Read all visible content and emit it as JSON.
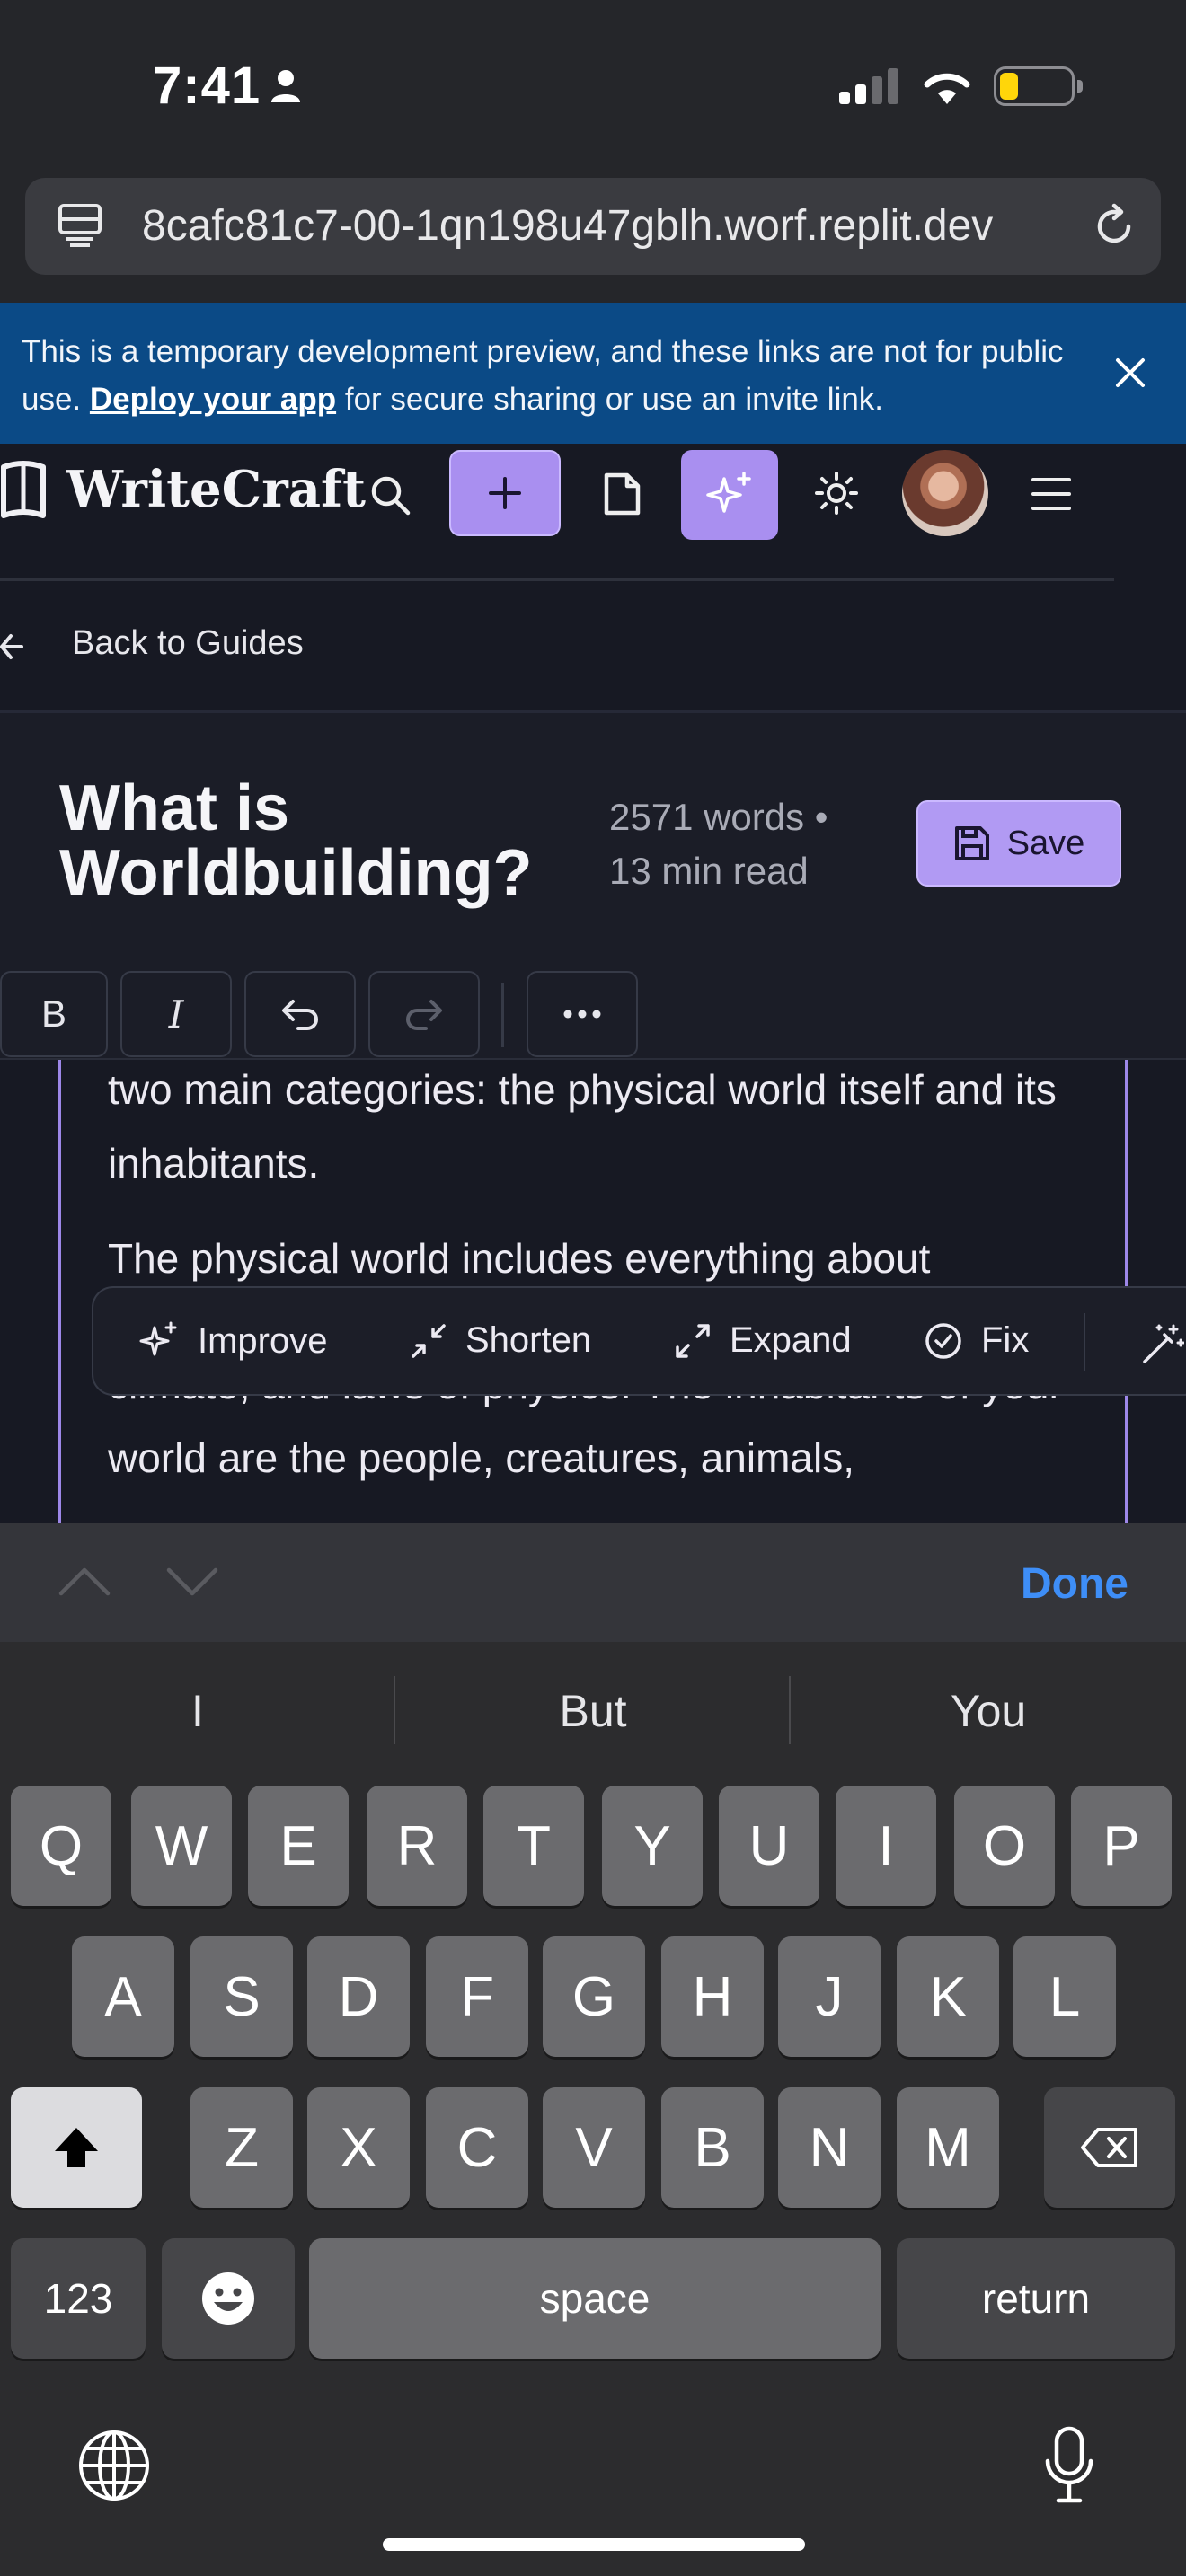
{
  "status_bar": {
    "time": "7:41"
  },
  "browser": {
    "url": "8cafc81c7-00-1qn198u47gblh.worf.replit.dev"
  },
  "banner": {
    "text_before": "This is a temporary development preview, and these links are not for public use.",
    "link": "Deploy your app",
    "text_after": "for secure sharing or use an invite link."
  },
  "app": {
    "brand": "WriteCraft",
    "back_label": "Back to Guides",
    "title": "What is Worldbuilding?",
    "word_count": "2571 words •",
    "read_time": "13 min read",
    "save_label": "Save",
    "toolbar": {
      "bold": "B",
      "italic": "I"
    },
    "content": {
      "p1": "two main categories: the physical world itself and its inhabitants.",
      "p2a": "The physical world includes everything about",
      "p2b": "climate, and laws of physics. The inhabitants of your world are the people, creatures, animals,"
    },
    "ai_actions": {
      "improve": "Improve",
      "shorten": "Shorten",
      "expand": "Expand",
      "fix": "Fix"
    },
    "colors": {
      "accent": "#b19af3",
      "background": "#171923"
    }
  },
  "keyboard": {
    "done": "Done",
    "suggestions": [
      "I",
      "But",
      "You"
    ],
    "row1": [
      "Q",
      "W",
      "E",
      "R",
      "T",
      "Y",
      "U",
      "I",
      "O",
      "P"
    ],
    "row2": [
      "A",
      "S",
      "D",
      "F",
      "G",
      "H",
      "J",
      "K",
      "L"
    ],
    "row3": [
      "Z",
      "X",
      "C",
      "V",
      "B",
      "N",
      "M"
    ],
    "numbers": "123",
    "space": "space",
    "return": "return"
  }
}
